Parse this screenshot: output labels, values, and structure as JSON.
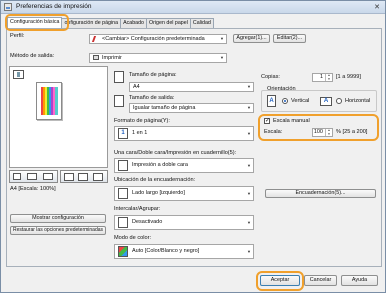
{
  "window": {
    "title": "Preferencias de impresión"
  },
  "tabs": [
    {
      "label": "Configuración básica"
    },
    {
      "label": "onfiguración de página"
    },
    {
      "label": "Acabado"
    },
    {
      "label": "Origen del papel"
    },
    {
      "label": "Calidad"
    }
  ],
  "profile": {
    "label": "Perfil:",
    "value": "<Cambiar> Configuración predeterminada",
    "add": "Agregar(1)...",
    "edit": "Editar(2)..."
  },
  "output": {
    "label": "Método de salida:",
    "value": "Imprimir"
  },
  "preview": {
    "caption": "A4 [Escala: 100%]"
  },
  "paper": {
    "page_size_label": "Tamaño de página:",
    "page_size_value": "A4",
    "output_size_label": "Tamaño de salida:",
    "output_size_value": "Igualar tamaño de página"
  },
  "copies": {
    "label": "Copias:",
    "value": "1",
    "range": "[1 a 9999]"
  },
  "orientation": {
    "label": "Orientación",
    "portrait": "Vertical",
    "landscape": "Horizontal",
    "icon_letter": "A"
  },
  "scaling": {
    "manual_label": "Escala manual",
    "checked": "✓",
    "scale_label": "Escala:",
    "scale_value": "100",
    "scale_range": "% [25 a 200]"
  },
  "layout": {
    "label": "Formato de página(Y):",
    "value": "1 en 1",
    "icon_text": "1"
  },
  "duplex": {
    "label": "Una cara/Doble cara/Impresión en cuadernillo(5):",
    "value": "Impresión a doble cara"
  },
  "binding": {
    "label": "Ubicación de la encuadernación:",
    "value": "Lado largo [izquierdo]",
    "button": "Encuadernación(5)..."
  },
  "collate": {
    "label": "Intercalar/Agrupar:",
    "value": "Desactivado"
  },
  "color": {
    "label": "Modo de color:",
    "value": "Auto [Color/Blanco y negro]"
  },
  "left_buttons": {
    "show_settings": "Mostrar configuración",
    "restore": "Restaurar las opciones predeterminadas"
  },
  "footer": {
    "ok": "Aceptar",
    "cancel": "Cancelar",
    "help": "Ayuda"
  },
  "colors": {
    "highlight": "#f0a02c",
    "accent": "#1f5fbf"
  }
}
